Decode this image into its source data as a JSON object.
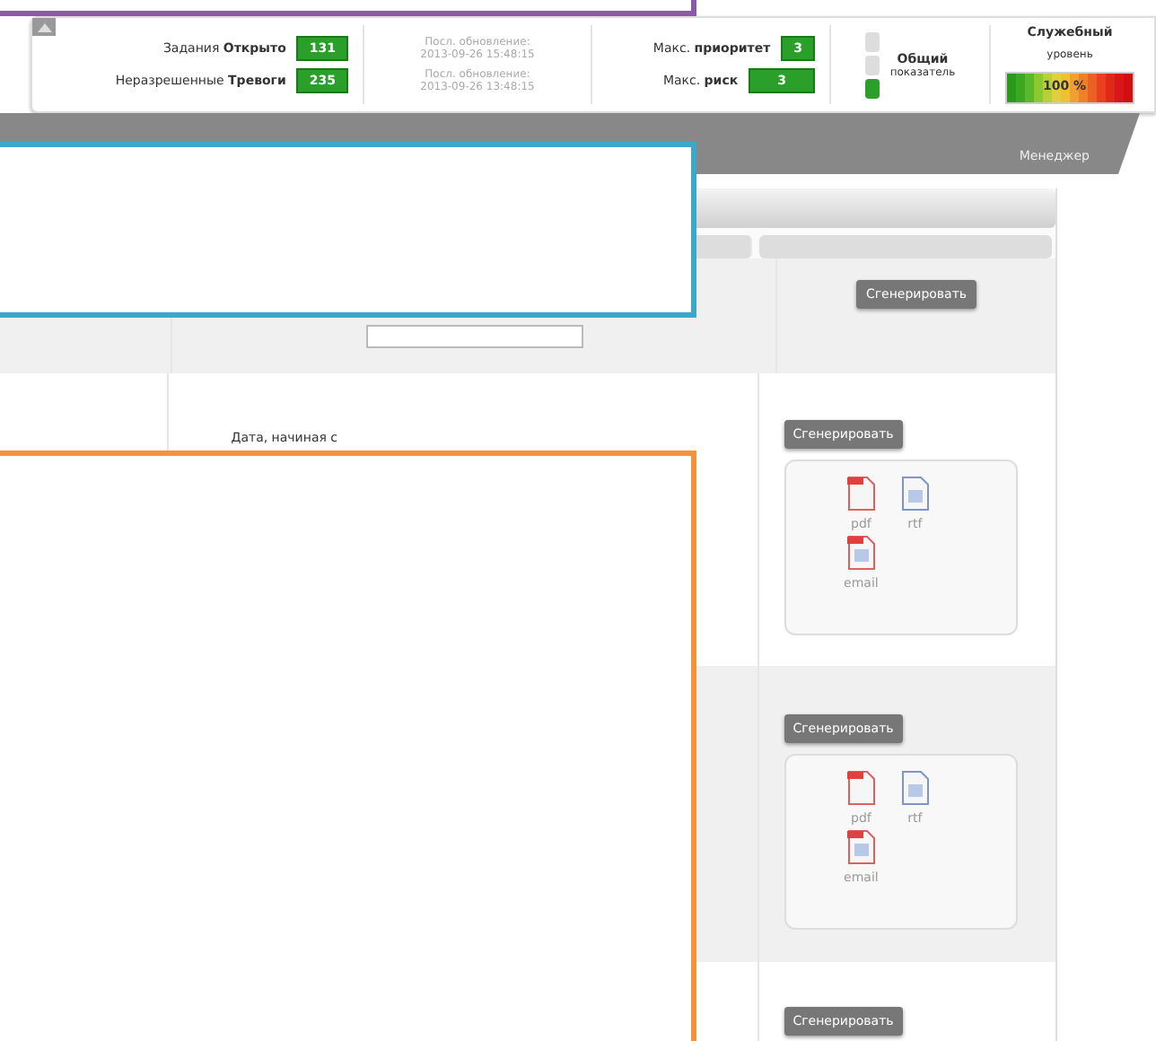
{
  "dashboard": {
    "counters": [
      {
        "label": "Задания **Открыто**",
        "value": "131"
      },
      {
        "label": "Неразрешенные **Тревоги**",
        "value": "235"
      }
    ],
    "updates": [
      {
        "label": "Посл. обновление:",
        "time": "2013-09-26 15:48:15"
      },
      {
        "label": "Посл. обновление:",
        "time": "2013-09-26 13:48:15"
      }
    ],
    "maxima": [
      {
        "label": "Макс. **приоритет**",
        "value": "3"
      },
      {
        "label": "Макс. **риск**",
        "value": "3"
      }
    ],
    "overall": {
      "title": "Общий",
      "subtitle": "показатель",
      "lights": [
        {
          "on": false
        },
        {
          "on": false
        },
        {
          "on": true
        }
      ]
    },
    "service_level": {
      "title": "Служебный",
      "subtitle": "уровень",
      "reading": "100 %"
    }
  },
  "nav": {
    "tabs": [
      {
        "label": "Менеджер"
      }
    ]
  },
  "table": {
    "rows": [
      {
        "kind": "input",
        "button": "Сгенерировать"
      },
      {
        "kind": "plain",
        "label": "Дата, начиная с",
        "button": "Сгенерировать",
        "exports": [
          "pdf",
          "rtf",
          "email"
        ]
      },
      {
        "kind": "plain",
        "button": "Сгенерировать",
        "exports": [
          "pdf",
          "rtf",
          "email"
        ]
      },
      {
        "kind": "plain",
        "button": "Сгенерировать"
      }
    ]
  }
}
